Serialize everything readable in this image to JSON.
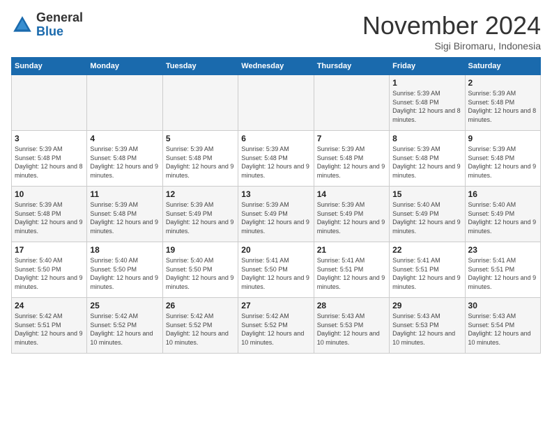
{
  "logo": {
    "general": "General",
    "blue": "Blue"
  },
  "title": "November 2024",
  "location": "Sigi Biromaru, Indonesia",
  "days_of_week": [
    "Sunday",
    "Monday",
    "Tuesday",
    "Wednesday",
    "Thursday",
    "Friday",
    "Saturday"
  ],
  "weeks": [
    [
      {
        "day": "",
        "info": ""
      },
      {
        "day": "",
        "info": ""
      },
      {
        "day": "",
        "info": ""
      },
      {
        "day": "",
        "info": ""
      },
      {
        "day": "",
        "info": ""
      },
      {
        "day": "1",
        "info": "Sunrise: 5:39 AM\nSunset: 5:48 PM\nDaylight: 12 hours and 8 minutes."
      },
      {
        "day": "2",
        "info": "Sunrise: 5:39 AM\nSunset: 5:48 PM\nDaylight: 12 hours and 8 minutes."
      }
    ],
    [
      {
        "day": "3",
        "info": "Sunrise: 5:39 AM\nSunset: 5:48 PM\nDaylight: 12 hours and 8 minutes."
      },
      {
        "day": "4",
        "info": "Sunrise: 5:39 AM\nSunset: 5:48 PM\nDaylight: 12 hours and 9 minutes."
      },
      {
        "day": "5",
        "info": "Sunrise: 5:39 AM\nSunset: 5:48 PM\nDaylight: 12 hours and 9 minutes."
      },
      {
        "day": "6",
        "info": "Sunrise: 5:39 AM\nSunset: 5:48 PM\nDaylight: 12 hours and 9 minutes."
      },
      {
        "day": "7",
        "info": "Sunrise: 5:39 AM\nSunset: 5:48 PM\nDaylight: 12 hours and 9 minutes."
      },
      {
        "day": "8",
        "info": "Sunrise: 5:39 AM\nSunset: 5:48 PM\nDaylight: 12 hours and 9 minutes."
      },
      {
        "day": "9",
        "info": "Sunrise: 5:39 AM\nSunset: 5:48 PM\nDaylight: 12 hours and 9 minutes."
      }
    ],
    [
      {
        "day": "10",
        "info": "Sunrise: 5:39 AM\nSunset: 5:48 PM\nDaylight: 12 hours and 9 minutes."
      },
      {
        "day": "11",
        "info": "Sunrise: 5:39 AM\nSunset: 5:48 PM\nDaylight: 12 hours and 9 minutes."
      },
      {
        "day": "12",
        "info": "Sunrise: 5:39 AM\nSunset: 5:49 PM\nDaylight: 12 hours and 9 minutes."
      },
      {
        "day": "13",
        "info": "Sunrise: 5:39 AM\nSunset: 5:49 PM\nDaylight: 12 hours and 9 minutes."
      },
      {
        "day": "14",
        "info": "Sunrise: 5:39 AM\nSunset: 5:49 PM\nDaylight: 12 hours and 9 minutes."
      },
      {
        "day": "15",
        "info": "Sunrise: 5:40 AM\nSunset: 5:49 PM\nDaylight: 12 hours and 9 minutes."
      },
      {
        "day": "16",
        "info": "Sunrise: 5:40 AM\nSunset: 5:49 PM\nDaylight: 12 hours and 9 minutes."
      }
    ],
    [
      {
        "day": "17",
        "info": "Sunrise: 5:40 AM\nSunset: 5:50 PM\nDaylight: 12 hours and 9 minutes."
      },
      {
        "day": "18",
        "info": "Sunrise: 5:40 AM\nSunset: 5:50 PM\nDaylight: 12 hours and 9 minutes."
      },
      {
        "day": "19",
        "info": "Sunrise: 5:40 AM\nSunset: 5:50 PM\nDaylight: 12 hours and 9 minutes."
      },
      {
        "day": "20",
        "info": "Sunrise: 5:41 AM\nSunset: 5:50 PM\nDaylight: 12 hours and 9 minutes."
      },
      {
        "day": "21",
        "info": "Sunrise: 5:41 AM\nSunset: 5:51 PM\nDaylight: 12 hours and 9 minutes."
      },
      {
        "day": "22",
        "info": "Sunrise: 5:41 AM\nSunset: 5:51 PM\nDaylight: 12 hours and 9 minutes."
      },
      {
        "day": "23",
        "info": "Sunrise: 5:41 AM\nSunset: 5:51 PM\nDaylight: 12 hours and 9 minutes."
      }
    ],
    [
      {
        "day": "24",
        "info": "Sunrise: 5:42 AM\nSunset: 5:51 PM\nDaylight: 12 hours and 9 minutes."
      },
      {
        "day": "25",
        "info": "Sunrise: 5:42 AM\nSunset: 5:52 PM\nDaylight: 12 hours and 10 minutes."
      },
      {
        "day": "26",
        "info": "Sunrise: 5:42 AM\nSunset: 5:52 PM\nDaylight: 12 hours and 10 minutes."
      },
      {
        "day": "27",
        "info": "Sunrise: 5:42 AM\nSunset: 5:52 PM\nDaylight: 12 hours and 10 minutes."
      },
      {
        "day": "28",
        "info": "Sunrise: 5:43 AM\nSunset: 5:53 PM\nDaylight: 12 hours and 10 minutes."
      },
      {
        "day": "29",
        "info": "Sunrise: 5:43 AM\nSunset: 5:53 PM\nDaylight: 12 hours and 10 minutes."
      },
      {
        "day": "30",
        "info": "Sunrise: 5:43 AM\nSunset: 5:54 PM\nDaylight: 12 hours and 10 minutes."
      }
    ]
  ]
}
